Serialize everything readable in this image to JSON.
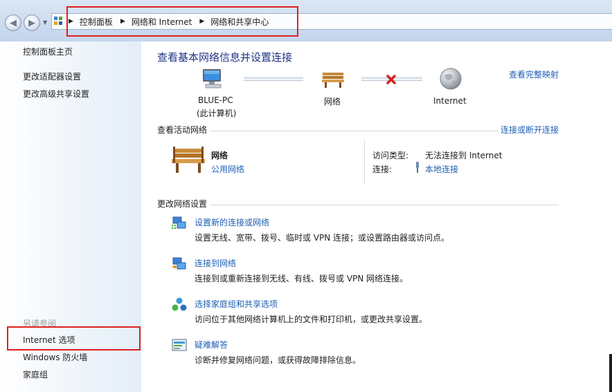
{
  "breadcrumb": {
    "items": [
      "控制面板",
      "网络和 Internet",
      "网络和共享中心"
    ]
  },
  "sidebar": {
    "links": [
      "控制面板主页",
      "更改适配器设置",
      "更改高级共享设置"
    ],
    "see_also_heading": "另请参阅",
    "see_also": [
      "Internet 选项",
      "Windows 防火墙",
      "家庭组"
    ]
  },
  "main": {
    "title": "查看基本网络信息并设置连接",
    "full_map_link": "查看完整映射",
    "map": {
      "computer_name": "BLUE-PC",
      "computer_sub": "(此计算机)",
      "network_label": "网络",
      "internet_label": "Internet"
    },
    "active": {
      "heading": "查看活动网络",
      "connect_link": "连接或断开连接",
      "network_name": "网络",
      "network_type": "公用网络",
      "access_type_key": "访问类型:",
      "access_type_value": "无法连接到 Internet",
      "connections_key": "连接:",
      "connections_value": "本地连接"
    },
    "change": {
      "heading": "更改网络设置",
      "tasks": [
        {
          "title": "设置新的连接或网络",
          "desc": "设置无线、宽带、拨号、临时或 VPN 连接；或设置路由器或访问点。"
        },
        {
          "title": "连接到网络",
          "desc": "连接到或重新连接到无线、有线、拨号或 VPN 网络连接。"
        },
        {
          "title": "选择家庭组和共享选项",
          "desc": "访问位于其他网络计算机上的文件和打印机，或更改共享设置。"
        },
        {
          "title": "疑难解答",
          "desc": "诊断并修复网络问题，或获得故障排除信息。"
        }
      ]
    }
  },
  "colors": {
    "highlight_box": "#e0201f",
    "link": "#1e5fb4",
    "title": "#1e3287"
  }
}
